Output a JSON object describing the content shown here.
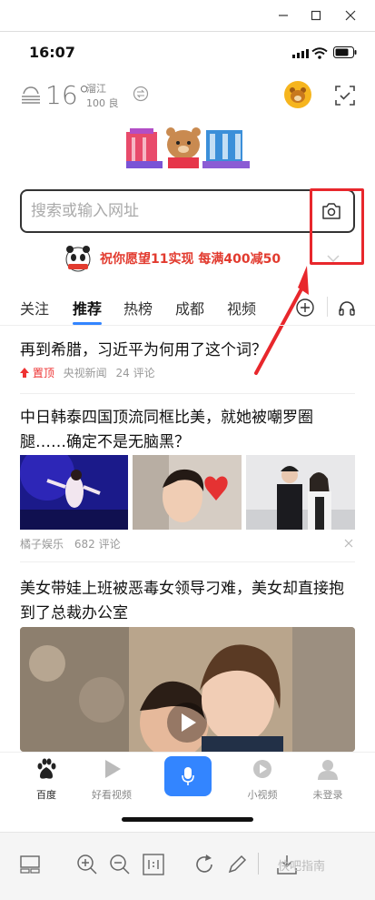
{
  "status_bar": {
    "time": "16:07"
  },
  "weather": {
    "temperature": "16°",
    "city": "溜江",
    "aqi_value": "100",
    "aqi_level": "良"
  },
  "search": {
    "placeholder": "搜索或输入网址"
  },
  "promo": {
    "text": "祝你愿望11实现 每满400减50"
  },
  "tabs": [
    {
      "label": "关注"
    },
    {
      "label": "推荐"
    },
    {
      "label": "热榜"
    },
    {
      "label": "成都"
    },
    {
      "label": "视频"
    }
  ],
  "feed": {
    "items": [
      {
        "title": "再到希腊，习近平为何用了这个词？",
        "tag": "置顶",
        "source": "央视新闻",
        "comments": "24 评论"
      },
      {
        "title": "中日韩泰四国顶流同框比美，就她被嘲罗圈腿……确定不是无脑黑？",
        "source": "橘子娱乐",
        "comments": "682 评论"
      },
      {
        "title": "美女带娃上班被恶毒女领导刁难，美女却直接抱到了总裁办公室"
      }
    ]
  },
  "bottom_nav": [
    {
      "label": "百度"
    },
    {
      "label": "好看视频"
    },
    {
      "label": "小视频"
    },
    {
      "label": "未登录"
    }
  ],
  "watermark": "快吧指南",
  "colors": {
    "accent": "#3385ff",
    "highlight": "#e8272c",
    "promo": "#e23b2f"
  }
}
